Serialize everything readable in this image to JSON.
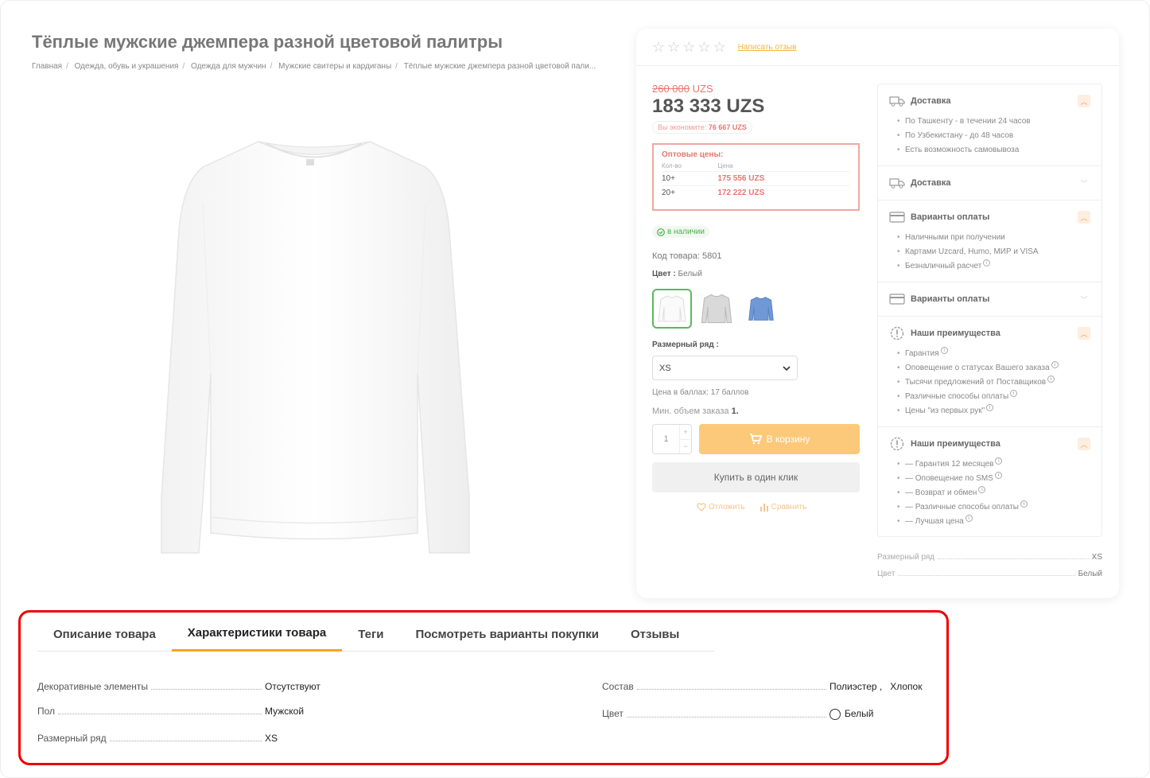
{
  "page": {
    "title": "Тёплые мужские джемпера разной цветовой палитры",
    "breadcrumbs": [
      "Главная",
      "Одежда, обувь и украшения",
      "Одежда для мужчин",
      "Мужские свитеры и кардиганы",
      "Тёплые мужские джемпера разной цветовой пали..."
    ],
    "breadcrumb_separator": "/"
  },
  "product": {
    "rating_stars": 0,
    "write_review": "Написать отзыв",
    "old_price": "260 000",
    "old_price_currency": "UZS",
    "price": "183 333 UZS",
    "savings_label": "Вы экономите:",
    "savings_value": "76 667 UZS",
    "wholesale": {
      "title": "Оптовые цены:",
      "col_qty": "Кол-во",
      "col_price": "Цена",
      "rows": [
        {
          "qty": "10+",
          "price": "175 556 UZS"
        },
        {
          "qty": "20+",
          "price": "172 222 UZS"
        }
      ]
    },
    "stock": "в наличии",
    "code": "Код товара: 5801",
    "color_label": "Цвет :",
    "color_value": "Белый",
    "swatches": [
      {
        "name": "white",
        "color": "#ffffff"
      },
      {
        "name": "grey",
        "color": "#d9d9d9"
      },
      {
        "name": "blue",
        "color": "#6f98d6"
      }
    ],
    "size_label": "Размерный ряд :",
    "size_value": "XS",
    "points": "Цена в баллах: 17 баллов",
    "min_order_label": "Мин. объем заказа",
    "min_order_value": "1.",
    "qty": "1",
    "qty_plus": "+",
    "qty_minus": "−",
    "cart_button": "В корзину",
    "oneclick_button": "Купить в один клик",
    "defer": "Отложить",
    "compare": "Сравнить"
  },
  "info": [
    {
      "title": "Доставка",
      "icon": "truck-icon",
      "open": true,
      "items": [
        "По Ташкенту - в течении 24 часов",
        "По Узбекистану - до 48 часов",
        "Есть возможность самовывоза"
      ],
      "help": []
    },
    {
      "title": "Доставка",
      "icon": "truck-icon",
      "open": false,
      "items": [],
      "help": []
    },
    {
      "title": "Варианты оплаты",
      "icon": "card-icon",
      "open": true,
      "items": [
        "Наличными при получении",
        "Картами Uzcard, Humo, МИР и VISA",
        "Безналичный расчет"
      ],
      "help": [
        2
      ]
    },
    {
      "title": "Варианты оплаты",
      "icon": "card-icon",
      "open": false,
      "items": [],
      "help": []
    },
    {
      "title": "Наши преимущества",
      "icon": "badge-icon",
      "open": true,
      "items": [
        "Гарантия",
        "Оповещение о статусах Вашего заказа",
        "Тысячи предложений от Поставщиков",
        "Различные способы оплаты",
        "Цены \"из первых рук\""
      ],
      "help": [
        0,
        1,
        2,
        3,
        4
      ]
    },
    {
      "title": "Наши преимущества",
      "icon": "badge-icon",
      "open": true,
      "items": [
        "— Гарантия 12 месяцев",
        "— Оповещение по SMS",
        "— Возврат и обмен",
        "— Различные способы оплаты",
        "— Лучшая цена"
      ],
      "help": [
        0,
        1,
        2,
        3,
        4
      ]
    }
  ],
  "specs_short": [
    {
      "key": "Размерный ряд",
      "value": "XS"
    },
    {
      "key": "Цвет",
      "value": "Белый"
    }
  ],
  "tabs": [
    {
      "label": "Описание товара",
      "active": false
    },
    {
      "label": "Характеристики товара",
      "active": true
    },
    {
      "label": "Теги",
      "active": false
    },
    {
      "label": "Посмотреть варианты покупки",
      "active": false
    },
    {
      "label": "Отзывы",
      "active": false
    }
  ],
  "characteristics": {
    "left": [
      {
        "key": "Декоративные элементы",
        "value": "Отсутствуют"
      },
      {
        "key": "Пол",
        "value": "Мужской"
      },
      {
        "key": "Размерный ряд",
        "value": "XS"
      }
    ],
    "right": [
      {
        "key": "Состав",
        "value": "Полиэстер ,   Хлопок"
      },
      {
        "key": "Цвет",
        "value": "Белый"
      }
    ]
  },
  "colors": {
    "accent": "#f5a623",
    "sale": "#e8776e",
    "highlight": "#e00000"
  }
}
